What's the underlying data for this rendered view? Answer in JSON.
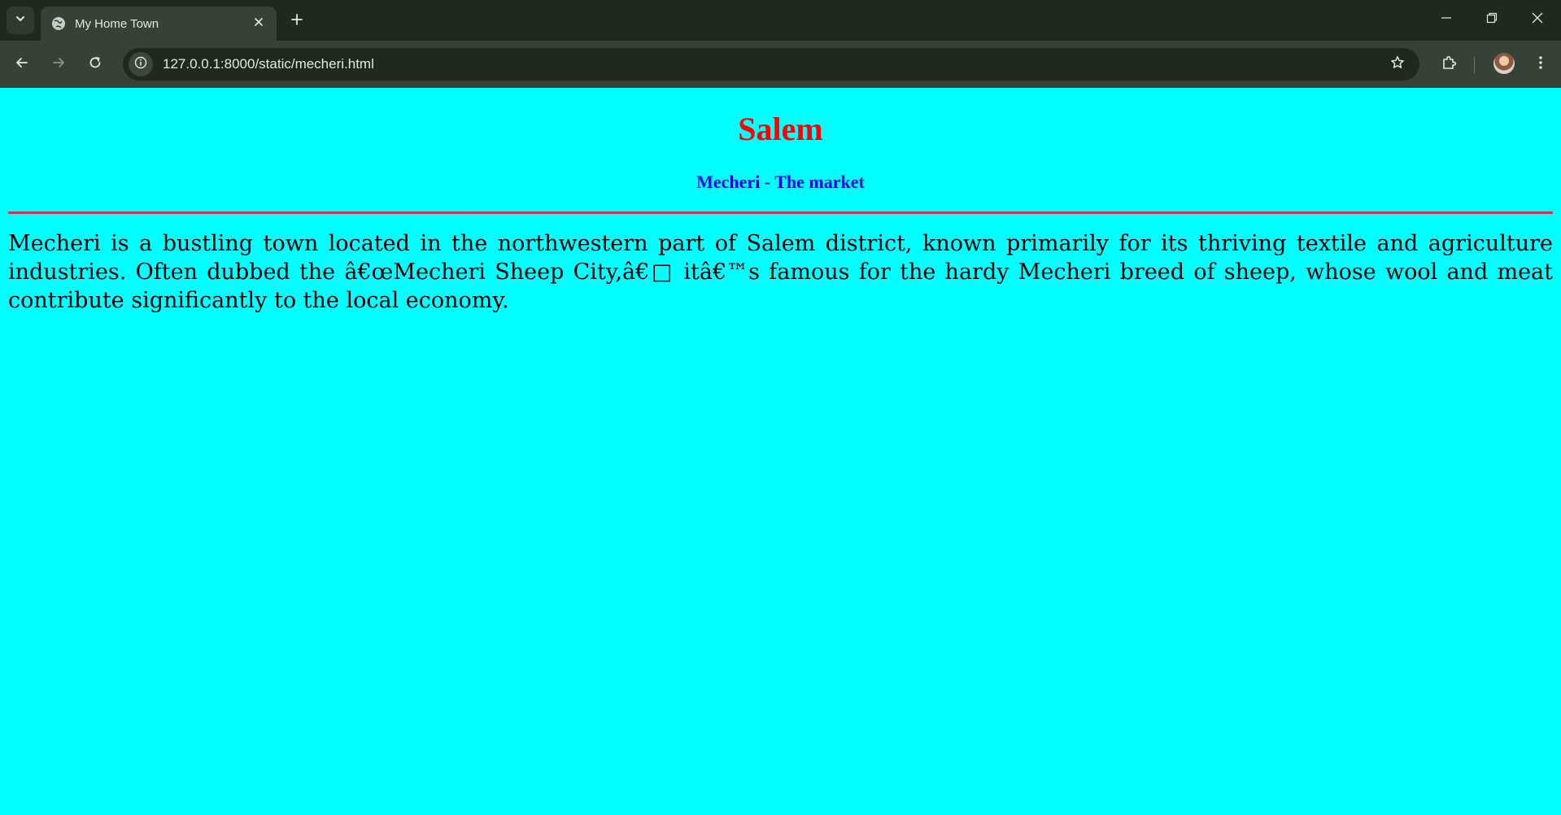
{
  "browser": {
    "tab_title": "My Home Town",
    "url": "127.0.0.1:8000/static/mecheri.html",
    "icons": {
      "tab_search": "chevron-down-icon",
      "favicon": "globe-icon",
      "tab_close": "close-icon",
      "new_tab": "plus-icon",
      "minimize": "minimize-icon",
      "restore": "restore-icon",
      "close_window": "close-icon",
      "back": "arrow-left-icon",
      "forward": "arrow-right-icon",
      "reload": "reload-icon",
      "site_info": "info-icon",
      "bookmark": "star-icon",
      "extensions": "puzzle-icon",
      "profile": "avatar",
      "menu": "kebab-menu-icon"
    },
    "colors": {
      "frame": "#1d2a1c",
      "toolbar": "#364235"
    }
  },
  "page": {
    "background": "#00ffff",
    "title": "Salem",
    "subtitle": "Mecheri - The market",
    "paragraph": "Mecheri is a bustling town located in the northwestern part of Salem district, known primarily for its thriving textile and agriculture industries. Often dubbed the â€œMecheri Sheep City,â€□ itâ€™s famous for the hardy Mecheri breed of sheep, whose wool and meat contribute significantly to the local economy.",
    "colors": {
      "title": "#ff0000",
      "subtitle": "#0000ff",
      "divider": "#c43a56"
    }
  }
}
